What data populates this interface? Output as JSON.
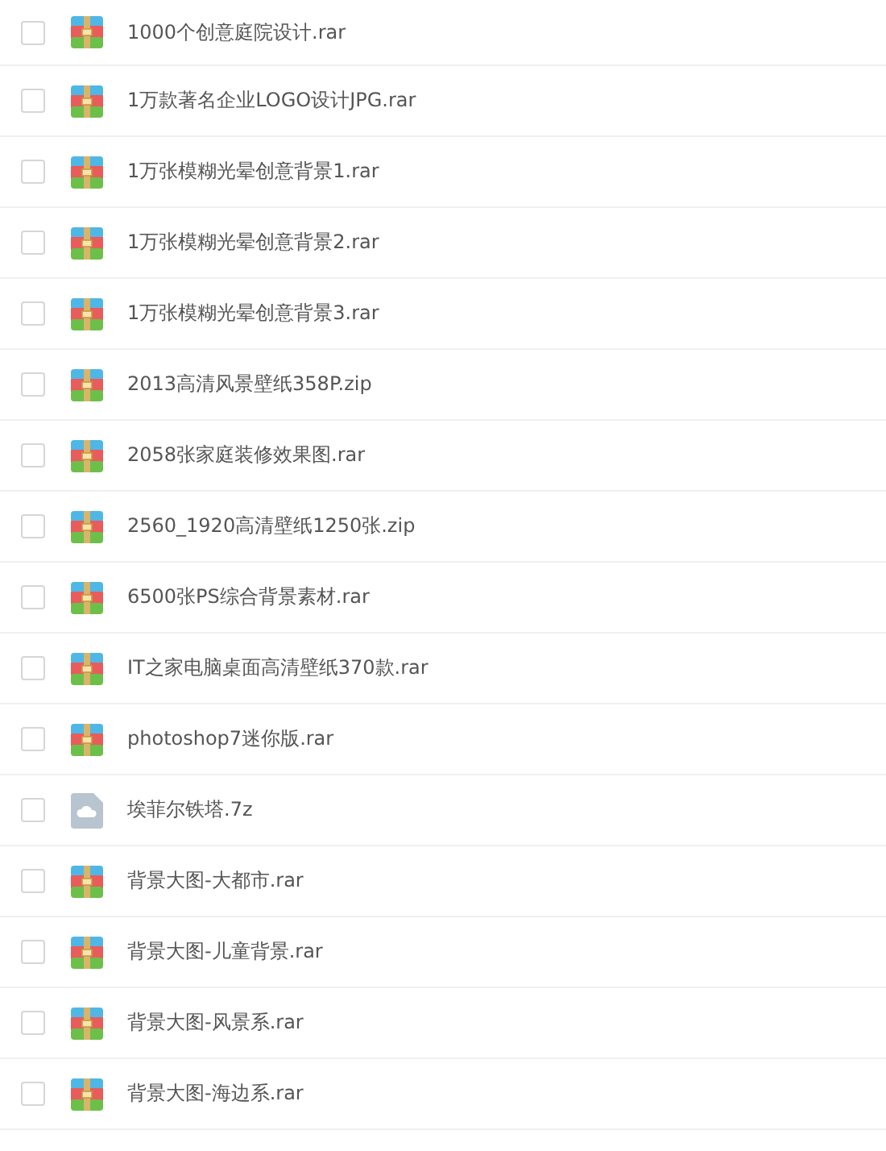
{
  "files": [
    {
      "name": "1000个创意庭院设计.rar",
      "kind": "archive",
      "checked": false
    },
    {
      "name": "1万款著名企业LOGO设计JPG.rar",
      "kind": "archive",
      "checked": false
    },
    {
      "name": "1万张模糊光晕创意背景1.rar",
      "kind": "archive",
      "checked": false
    },
    {
      "name": "1万张模糊光晕创意背景2.rar",
      "kind": "archive",
      "checked": false
    },
    {
      "name": "1万张模糊光晕创意背景3.rar",
      "kind": "archive",
      "checked": false
    },
    {
      "name": "2013高清风景壁纸358P.zip",
      "kind": "archive",
      "checked": false
    },
    {
      "name": "2058张家庭装修效果图.rar",
      "kind": "archive",
      "checked": false
    },
    {
      "name": "2560_1920高清壁纸1250张.zip",
      "kind": "archive",
      "checked": false
    },
    {
      "name": "6500张PS综合背景素材.rar",
      "kind": "archive",
      "checked": false
    },
    {
      "name": "IT之家电脑桌面高清壁纸370款.rar",
      "kind": "archive",
      "checked": false
    },
    {
      "name": "photoshop7迷你版.rar",
      "kind": "archive",
      "checked": false
    },
    {
      "name": "埃菲尔铁塔.7z",
      "kind": "cloud",
      "checked": false
    },
    {
      "name": "背景大图-大都市.rar",
      "kind": "archive",
      "checked": false
    },
    {
      "name": "背景大图-儿童背景.rar",
      "kind": "archive",
      "checked": false
    },
    {
      "name": "背景大图-风景系.rar",
      "kind": "archive",
      "checked": false
    },
    {
      "name": "背景大图-海边系.rar",
      "kind": "archive",
      "checked": false
    }
  ]
}
